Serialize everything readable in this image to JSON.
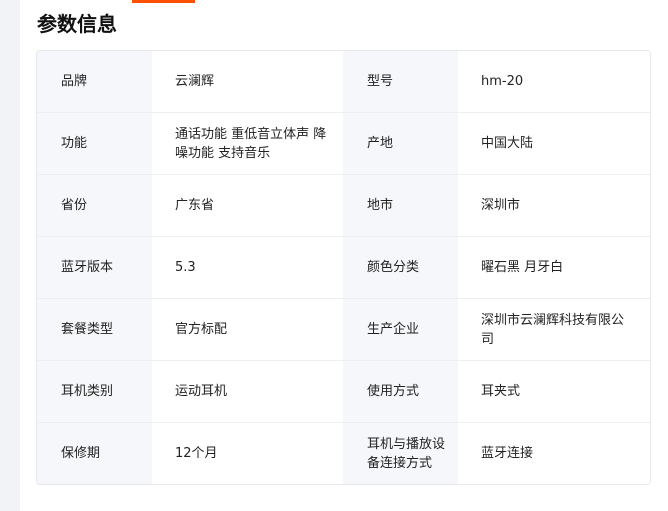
{
  "title": "参数信息",
  "rows": [
    {
      "k1": "品牌",
      "v1": "云澜辉",
      "k2": "型号",
      "v2": "hm-20"
    },
    {
      "k1": "功能",
      "v1": "通话功能 重低音立体声 降噪功能 支持音乐",
      "k2": "产地",
      "v2": "中国大陆"
    },
    {
      "k1": "省份",
      "v1": "广东省",
      "k2": "地市",
      "v2": "深圳市"
    },
    {
      "k1": "蓝牙版本",
      "v1": "5.3",
      "k2": "颜色分类",
      "v2": "曜石黑 月牙白"
    },
    {
      "k1": "套餐类型",
      "v1": "官方标配",
      "k2": "生产企业",
      "v2": "深圳市云澜辉科技有限公司"
    },
    {
      "k1": "耳机类别",
      "v1": "运动耳机",
      "k2": "使用方式",
      "v2": "耳夹式"
    },
    {
      "k1": "保修期",
      "v1": "12个月",
      "k2": "耳机与播放设备连接方式",
      "v2": "蓝牙连接"
    }
  ],
  "colors": {
    "accent": "#ff5000",
    "key_bg": "#f5f7fa",
    "border": "#e6e8eb"
  }
}
